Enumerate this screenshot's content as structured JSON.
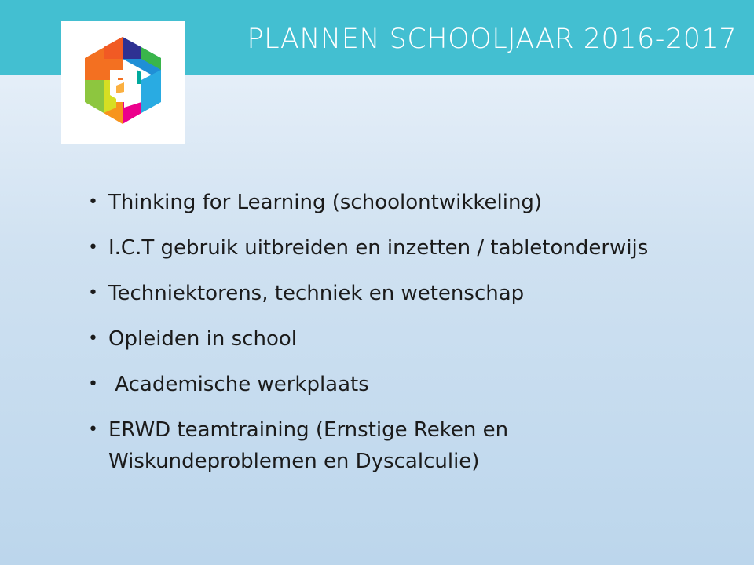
{
  "slide": {
    "title": "PLANNEN SCHOOLJAAR 2016-2017",
    "logo_icon": "hexagon-logo-icon",
    "bullet_symbol": "•",
    "bullets": [
      "Thinking for Learning (schoolontwikkeling)",
      "I.C.T gebruik uitbreiden en inzetten / tabletonderwijs",
      "Techniektorens, techniek en wetenschap",
      "Opleiden in school",
      " Academische werkplaats",
      "ERWD teamtraining (Ernstige Reken en Wiskundeproblemen en Dyscalculie)"
    ]
  },
  "colors": {
    "title_bar": "#43bfd1",
    "title_text": "#ffffff",
    "body_text": "#1b1b1b",
    "background_top": "#eef4fb",
    "background_bottom": "#bcd6ec"
  }
}
